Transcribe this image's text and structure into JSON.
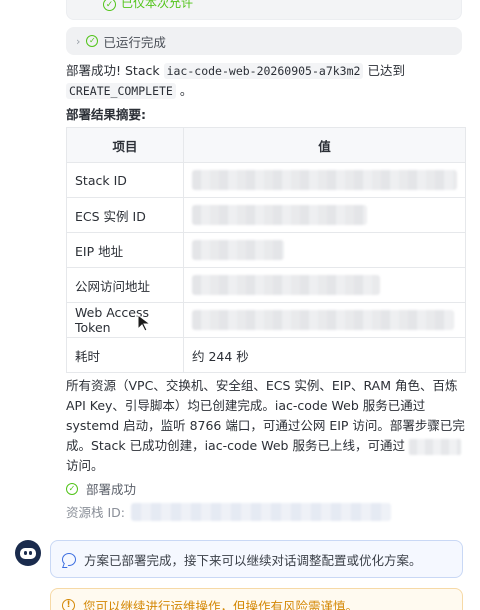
{
  "top_note": {
    "text": "已仅本次允许"
  },
  "run_status": {
    "label": "已运行完成"
  },
  "message": {
    "prefix": "部署成功! Stack",
    "stack_name": "iac-code-web-20260905-a7k3m2",
    "middle": "已达到",
    "status_code": "CREATE_COMPLETE",
    "suffix": "。"
  },
  "result_title": "部署结果摘要:",
  "result_table": {
    "headers": [
      "项目",
      "值"
    ],
    "rows": [
      {
        "key": "Stack ID",
        "value": ""
      },
      {
        "key": "ECS 实例 ID",
        "value": ""
      },
      {
        "key": "EIP 地址",
        "value": ""
      },
      {
        "key": "公网访问地址",
        "value": ""
      },
      {
        "key": "Web Access Token",
        "value": ""
      },
      {
        "key": "耗时",
        "value": "约 244 秒"
      }
    ]
  },
  "summary": {
    "line1": "所有资源（VPC、交换机、安全组、ECS 实例、EIP、RAM 角色、百炼 API Key、引导脚本）均已创建完成。iac-code Web 服务已通过 systemd 启动，监听 8766 端口，可通过公网 EIP 访问。部署步骤已完成。Stack 已成功创建，iac-code Web 服务已上线，可通过",
    "line2": "访问。"
  },
  "deploy_success": "部署成功",
  "stack_id_label": "资源栈 ID:",
  "info_message": "方案已部署完成，接下来可以继续对话调整配置或优化方案。",
  "warning_message": "您可以继续进行运维操作，但操作有风险需谨慎。",
  "colors": {
    "success": "#52c41a",
    "info_border": "#c9d8f5",
    "warning": "#d48806"
  }
}
